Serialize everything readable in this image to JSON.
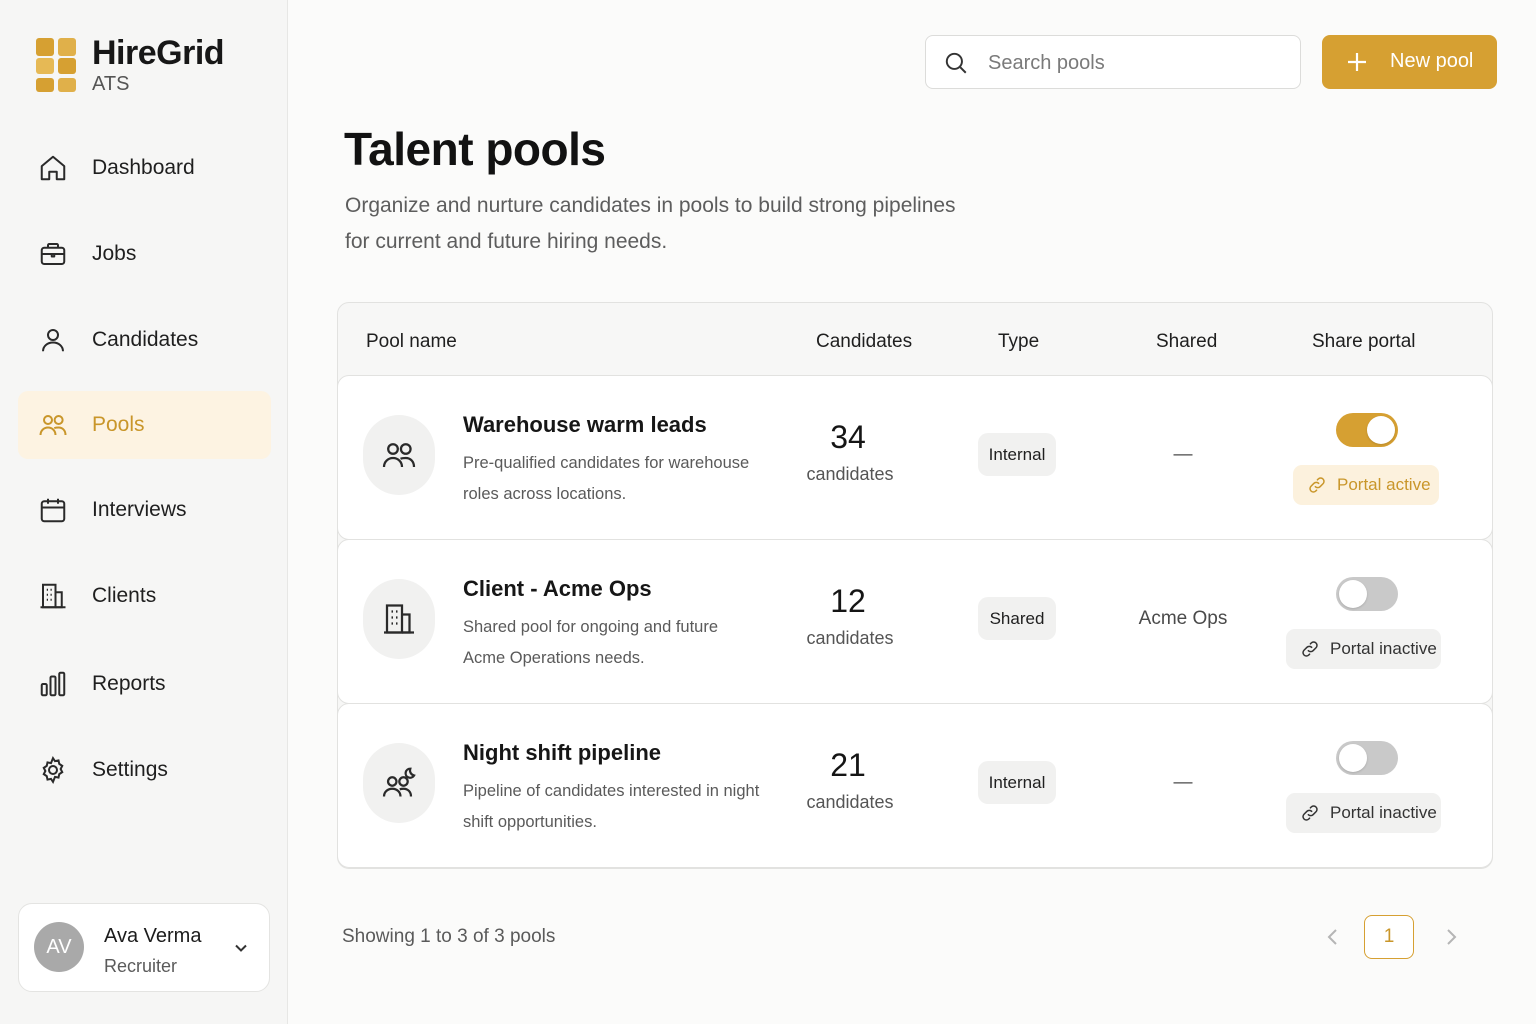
{
  "brand": {
    "name": "HireGrid",
    "sub": "ATS",
    "accent": "#d6a032"
  },
  "sidebar": {
    "items": [
      {
        "label": "Dashboard",
        "icon": "home-icon"
      },
      {
        "label": "Jobs",
        "icon": "briefcase-icon"
      },
      {
        "label": "Candidates",
        "icon": "user-icon"
      },
      {
        "label": "Pools",
        "icon": "users-icon",
        "active": true
      },
      {
        "label": "Interviews",
        "icon": "calendar-icon"
      },
      {
        "label": "Clients",
        "icon": "building-icon"
      },
      {
        "label": "Reports",
        "icon": "bar-chart-icon"
      },
      {
        "label": "Settings",
        "icon": "gear-icon"
      }
    ]
  },
  "user": {
    "initials": "AV",
    "name": "Ava Verma",
    "role": "Recruiter"
  },
  "search": {
    "placeholder": "Search pools",
    "value": ""
  },
  "actions": {
    "new_pool": "New pool"
  },
  "page": {
    "title": "Talent pools",
    "description": "Organize and nurture candidates in pools to build strong pipelines for current and future hiring needs."
  },
  "table": {
    "headers": [
      "Pool name",
      "Candidates",
      "Type",
      "Shared",
      "Share portal"
    ],
    "rows": [
      {
        "name": "Warehouse warm leads",
        "description": "Pre-qualified candidates for warehouse roles across locations.",
        "icon": "users-icon",
        "count": "34",
        "count_label": "candidates",
        "type": "Internal",
        "shared": "—",
        "portal_on": true,
        "portal_label": "Portal active"
      },
      {
        "name": "Client - Acme Ops",
        "description": "Shared pool for ongoing and future Acme Operations needs.",
        "icon": "building-icon",
        "count": "12",
        "count_label": "candidates",
        "type": "Shared",
        "shared": "Acme Ops",
        "portal_on": false,
        "portal_label": "Portal inactive"
      },
      {
        "name": "Night shift pipeline",
        "description": "Pipeline of candidates interested in night shift opportunities.",
        "icon": "users-moon-icon",
        "count": "21",
        "count_label": "candidates",
        "type": "Internal",
        "shared": "—",
        "portal_on": false,
        "portal_label": "Portal inactive"
      }
    ]
  },
  "footer": {
    "summary": "Showing 1 to 3 of 3 pools",
    "current_page": "1"
  }
}
